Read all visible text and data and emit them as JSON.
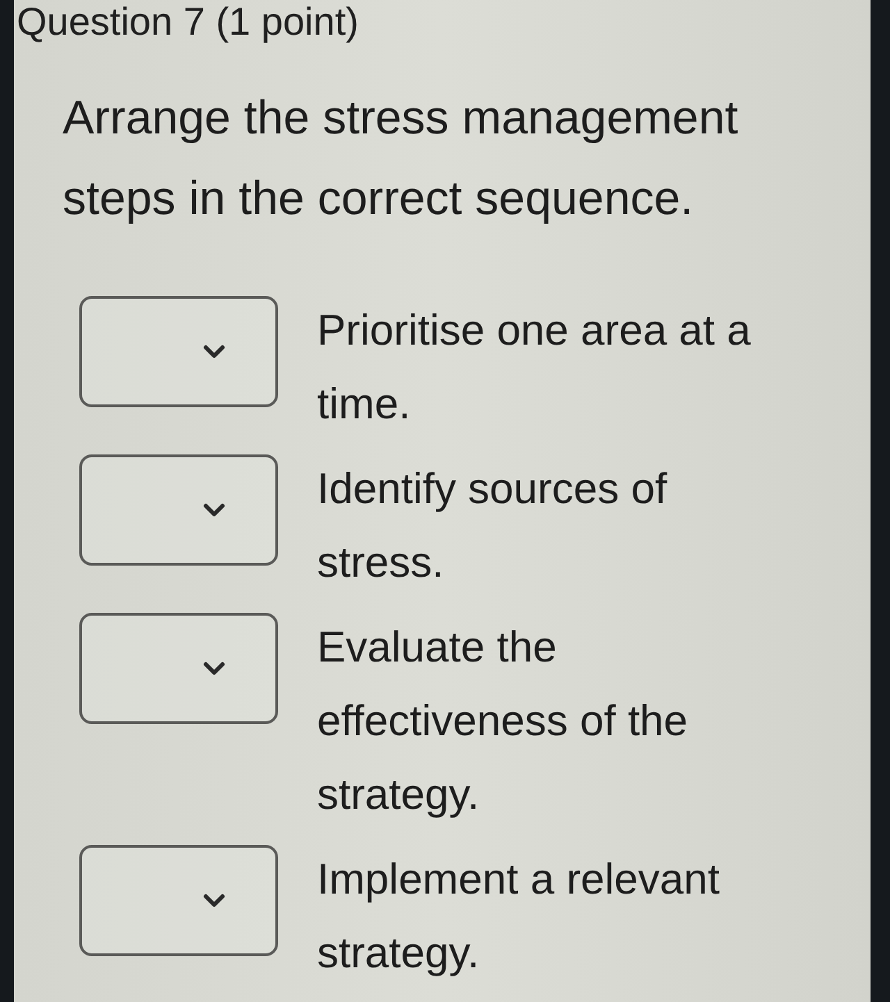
{
  "question": {
    "title": "Question 7 (1 point)",
    "prompt": "Arrange the stress management steps in the correct sequence."
  },
  "items": [
    {
      "text": "Prioritise one area at a time."
    },
    {
      "text": "Identify sources of stress."
    },
    {
      "text": "Evaluate the effectiveness of the strategy."
    },
    {
      "text": "Implement a relevant strategy."
    }
  ]
}
